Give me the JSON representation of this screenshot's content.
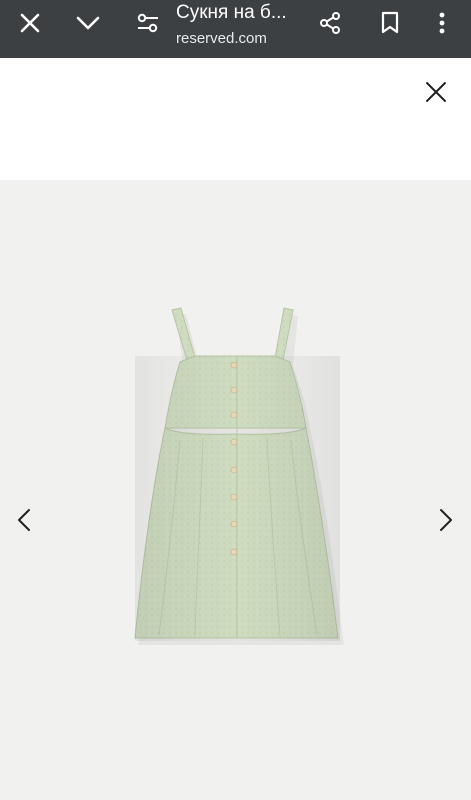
{
  "browser": {
    "page_title": "Сукня на б...",
    "url": "reserved.com",
    "icons": {
      "close": "close-icon",
      "collapse": "chevron-down-icon",
      "settings": "tune-icon",
      "share": "share-icon",
      "bookmark": "bookmark-icon",
      "menu": "more-vert-icon"
    }
  },
  "viewer": {
    "close": "close-icon",
    "prev": "chevron-left-icon",
    "next": "chevron-right-icon",
    "product_image": "green sleeveless button-front dress photo"
  },
  "colors": {
    "toolbar_bg": "#3c4043",
    "gallery_bg": "#f1f1ef",
    "dress_fabric": "#cfdcc0"
  }
}
